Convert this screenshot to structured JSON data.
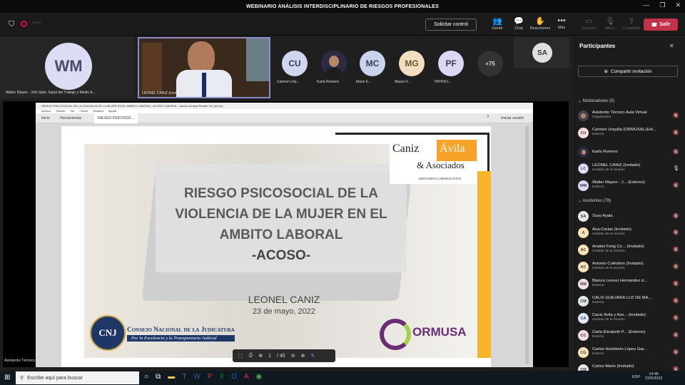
{
  "window": {
    "title": "WEBINARIO ANÁLISIS INTERDISCIPLINARIO DE RIESGOS PROFESIONALES",
    "controls": [
      "—",
      "❐",
      "✕"
    ]
  },
  "toolbar": {
    "timer": "--:--",
    "request_control": "Solicitar control",
    "buttons": [
      {
        "label": "Gente",
        "icon": "people-icon"
      },
      {
        "label": "Chat",
        "icon": "chat-icon"
      },
      {
        "label": "Reacciones",
        "icon": "reactions-icon"
      },
      {
        "label": "Más",
        "icon": "more-icon"
      },
      {
        "label": "Cámara",
        "icon": "camera-icon"
      },
      {
        "label": "Micro",
        "icon": "mic-icon"
      },
      {
        "label": "Compartir",
        "icon": "share-icon"
      }
    ],
    "leave": "Salir"
  },
  "tiles": {
    "main_initials": "WM",
    "main_name": "Walter Mayen - Jefe Dpto. Salud del Trabajo y Medio A...",
    "speaker_name": "LEONEL CANIZ (Invitado)",
    "row": [
      {
        "initials": "CU",
        "name": "Carmen Urq..."
      },
      {
        "initials": "",
        "name": "Karla Romero"
      },
      {
        "initials": "MC",
        "name": "Mario E..."
      },
      {
        "initials": "MG",
        "name": "Mayra V..."
      },
      {
        "initials": "PF",
        "name": "PATRICI..."
      }
    ],
    "overflow": "+75",
    "self_initials": "SA",
    "presenter_name": "Asistente Técnico Aula Virtual"
  },
  "shared": {
    "doc_title": "RIESGO PSICOSOCIAL DE LA VIOLENCIA DE LA MUJER EN EL AMBITO LABORAL -ACOSO LABORAL - Adobe Acrobat Reader DC (64-bit)",
    "menu": [
      "Archivo",
      "Edición",
      "Ver",
      "Firmar",
      "Ventana",
      "Ayuda"
    ],
    "tabs": [
      "Inicio",
      "Herramientas",
      "RIESGO PSICOSOC..."
    ],
    "signin": "Iniciar sesión",
    "page": "1",
    "pages": "/ 45"
  },
  "slide": {
    "logo_a": "Caniz",
    "logo_b": "Ávila",
    "logo_c": "& Asociados",
    "logo_sub": "ABOGADOS LABORALISTAS",
    "title1": "RIESGO PSICOSOCIAL DE LA",
    "title2": "VIOLENCIA DE LA MUJER EN EL",
    "title3": "AMBITO LABORAL",
    "title4": "-ACOSO-",
    "author": "LEONEL CANIZ",
    "date": "23 de mayo, 2022",
    "cnj_line1": "Consejo Nacional de la Judicatura",
    "cnj_line2": "Por la Excelencia y la Transparencia Judicial",
    "ormusa": "ORMUSA"
  },
  "panel": {
    "title": "Participantes",
    "invite": "Compartir invitación",
    "mods_header": "Moderadores (5)",
    "moderators": [
      {
        "initials": "",
        "name": "Asistente Técnico Aula Virtual",
        "sub": "Organizador"
      },
      {
        "initials": "CU",
        "name": "Carmen Urquilla (ORMUSA) (Ext...",
        "sub": "Externo"
      },
      {
        "initials": "",
        "name": "Karla Romero",
        "sub": ""
      },
      {
        "initials": "LC",
        "name": "LEONEL CANIZ (Invitado)",
        "sub": "Invitado de la reunión"
      },
      {
        "initials": "WM",
        "name": "Walter Mayen - J... (Externo)",
        "sub": "Externo"
      }
    ],
    "att_header": "Asistentes (78)",
    "attendees": [
      {
        "initials": "SA",
        "name": "Susy Ayala",
        "sub": ""
      },
      {
        "initials": "A",
        "name": "Ana-Carlas (Invitado)",
        "sub": "Invitado de la reunión"
      },
      {
        "initials": "AC",
        "name": "Anabel Fong Co... (Invitado)",
        "sub": "Invitado de la reunión"
      },
      {
        "initials": "AC",
        "name": "Antonio Colindres (Invitado)",
        "sub": "Invitado de la reunión"
      },
      {
        "initials": "BM",
        "name": "Blanca Leonor Hernández d...",
        "sub": "Externo"
      },
      {
        "initials": "CM",
        "name": "CALIX GUEVARA LUZ DE MA...",
        "sub": "Externo"
      },
      {
        "initials": "CA",
        "name": "Caniz Avila y Aso... (Invitado)",
        "sub": "Invitado de la reunión"
      },
      {
        "initials": "CC",
        "name": "Carla Elizabeth P... (Externo)",
        "sub": "Externo"
      },
      {
        "initials": "CG",
        "name": "Carlos Humberto López Gar...",
        "sub": "Externo"
      },
      {
        "initials": "CM",
        "name": "Carlos Mario (Invitado)",
        "sub": ""
      }
    ]
  },
  "taskbar": {
    "search": "Escribe aquí para buscar",
    "lang": "ESP",
    "time": "14:45",
    "date": "23/5/2022"
  }
}
